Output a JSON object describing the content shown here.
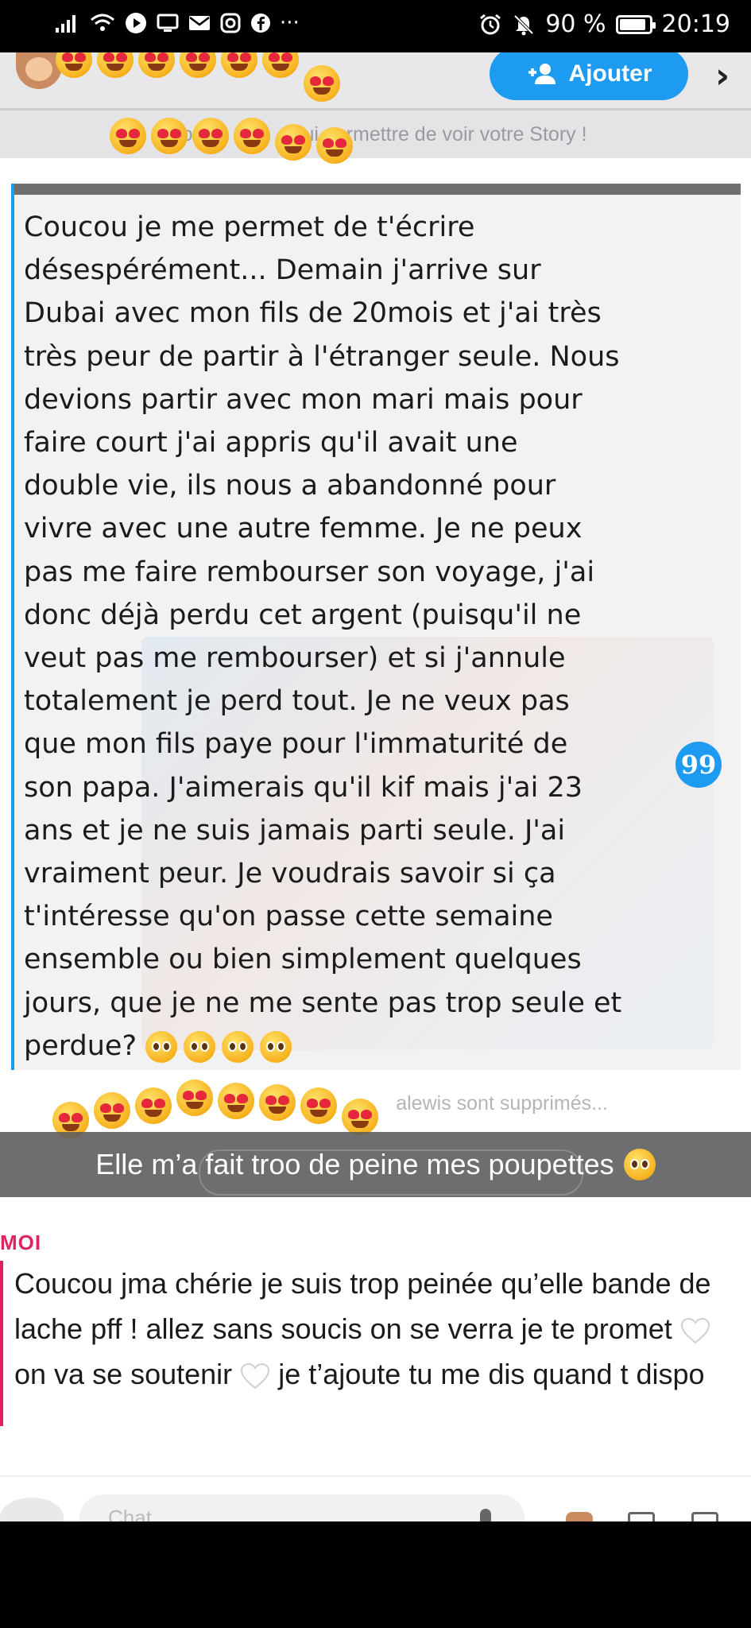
{
  "status_bar": {
    "battery": "90 %",
    "battery_level": 0.9,
    "time": "20:19",
    "left_icons": [
      "signal-icon",
      "wifi-icon",
      "play-icon",
      "screen-icon",
      "mail-icon",
      "instagram-icon",
      "facebook-icon",
      "more-icon"
    ],
    "right_icons": [
      "alarm-icon",
      "mute-icon",
      "battery-icon"
    ],
    "more": "···"
  },
  "header": {
    "add_button_label": "Ajouter",
    "add_button_icon": "add-friend-icon",
    "chevron": "›",
    "story_banner": "Ajo                    ui permettre de voir votre Story !"
  },
  "quoted_message": {
    "text": "Coucou je me permet de t'écrire\ndésespérément... Demain j'arrive sur\nDubai avec mon fils de 20mois et j'ai très\ntrès peur de partir à l'étranger seule. Nous\ndevions partir avec mon mari mais pour\nfaire court j'ai appris qu'il avait une\ndouble vie, ils nous a abandonné pour\nvivre avec une autre femme. Je ne peux\npas me faire rembourser son voyage, j'ai\ndonc déjà perdu cet argent (puisqu'il ne\nveut pas me rembourser) et si j'annule\ntotalement je perd tout. Je ne veux pas\nque mon fils paye pour l'immaturité de\nson papa. J'aimerais qu'il kif mais j'ai 23\nans et je ne suis jamais parti seule. J'ai\nvraiment peur. Je voudrais savoir si ça\nt'intéresse qu'on passe cette semaine\nensemble ou bien simplement quelques\njours, que je ne me sente pas trop seule et\nperdue?",
    "badge": "99",
    "accent": "#1d9bf0"
  },
  "deleted_notice": "alewis sont supprimés...",
  "caption": {
    "text": "Elle m’a fait troo de peine mes poupettes"
  },
  "reply": {
    "label": "MOI",
    "accent": "#e0245e",
    "part1": "Coucou jma chérie je suis trop peinée qu’elle bande de lache pff ! allez sans soucis on se verra je te promet",
    "part2": "on va se soutenir",
    "part3": "je t’ajoute tu me dis quand t dispo"
  },
  "compose": {
    "placeholder": "Chat"
  }
}
